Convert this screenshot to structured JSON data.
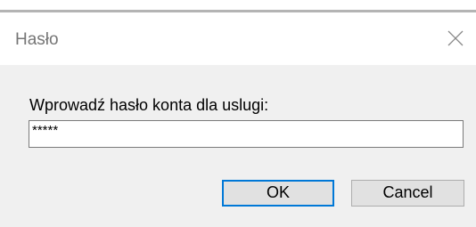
{
  "window": {
    "title": "Hasło",
    "close_icon": "close-icon"
  },
  "dialog": {
    "prompt": "Wprowadź hasło konta dla uslugi:",
    "password_mask": "*****"
  },
  "buttons": {
    "ok_label": "OK",
    "cancel_label": "Cancel"
  },
  "colors": {
    "accent": "#0078d7",
    "dialog_background": "#f0f0f0",
    "title_background": "#ffffff"
  }
}
